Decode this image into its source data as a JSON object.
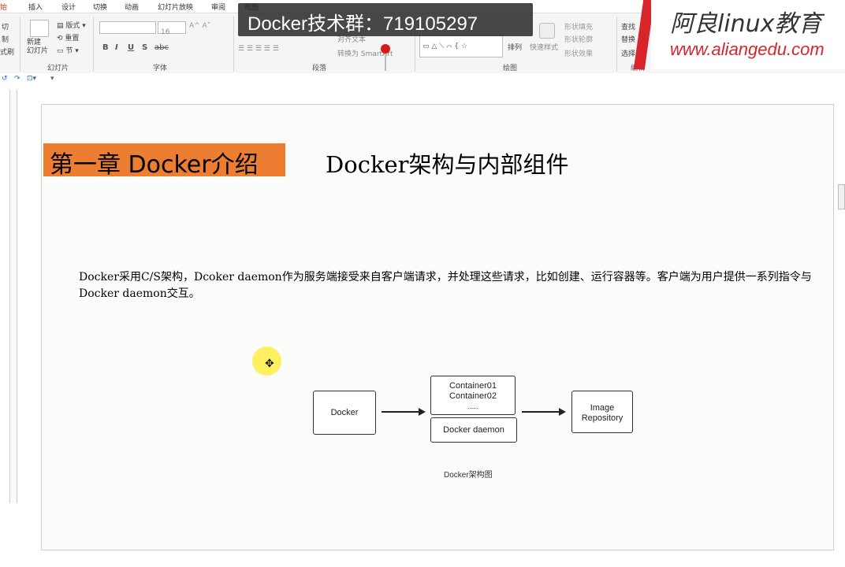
{
  "tabs": [
    "插入",
    "设计",
    "切换",
    "动画",
    "幻灯片放映",
    "审阅",
    "视图"
  ],
  "ribbon": {
    "left_labels": [
      "切",
      "制",
      "式刷"
    ],
    "new_slide": "新建\n幻灯片",
    "layout": "版式",
    "reset": "重置",
    "section": "节",
    "font_size": "16",
    "fmt": [
      "B",
      "I",
      "U",
      "S",
      "abc"
    ],
    "text_dir": "对齐文本",
    "smartart": "转换为 SmartArt",
    "arrange": "排列",
    "quick_styles": "快速样式",
    "shape_fill": "形状填充",
    "shape_outline": "形状轮廓",
    "shape_effects": "形状效果",
    "find": "查找",
    "replace": "替换",
    "select": "选择",
    "groups": {
      "slides": "幻灯片",
      "font": "字体",
      "paragraph": "段落",
      "drawing": "绘图",
      "editing": "编辑"
    }
  },
  "overlay": {
    "banner": "Docker技术群：719105297",
    "brand_name": "阿良linux教育",
    "brand_url": "www.aliangedu.com"
  },
  "slide": {
    "chapter": "第一章 Docker介绍",
    "title": "Docker架构与内部组件",
    "paragraph": "Docker采用C/S架构，Dcoker daemon作为服务端接受来自客户端请求，并处理这些请求，比如创建、运行容器等。客户端为用户提供一系列指令与Docker daemon交互。",
    "diagram": {
      "client": "Docker",
      "containers": [
        "Container01",
        "Container02",
        "....."
      ],
      "daemon": "Docker daemon",
      "registry": [
        "Image",
        "Repository"
      ],
      "caption": "Docker架构图"
    }
  },
  "colors": {
    "chapter_bg": "#ed7d31",
    "brand_red": "#d8242b",
    "active_tab": "#c43e1c"
  }
}
